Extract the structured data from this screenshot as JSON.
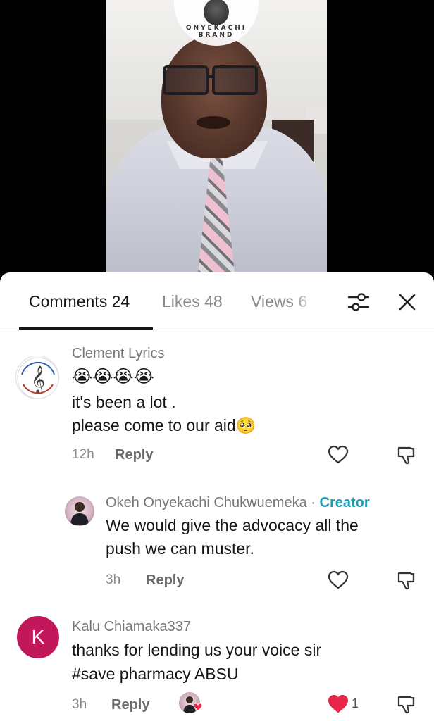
{
  "video": {
    "brand_text": "ONYEKACHI BRAND"
  },
  "tabs": {
    "comments": "Comments 24",
    "likes": "Likes 48",
    "views": "Views 6"
  },
  "icons": {
    "filter": "filter-sliders-icon",
    "close": "close-icon",
    "heart": "heart-icon",
    "dislike": "thumbs-down-icon"
  },
  "colors": {
    "creator": "#1aa0b8",
    "heart_liked": "#e8264a",
    "avatar_k": "#c2185b"
  },
  "comments": [
    {
      "username": "Clement Lyrics",
      "emoji_line": "😭😭😭😭",
      "line1": "it's been a lot .",
      "line2": "please come to our aid🥺",
      "time": "12h",
      "reply_label": "Reply"
    },
    {
      "username": "Okeh Onyekachi Chukwuemeka",
      "separator": "·",
      "badge": "Creator",
      "line1": "We would give the advocacy all the",
      "line2": "push we can muster.",
      "time": "3h",
      "reply_label": "Reply"
    },
    {
      "avatar_letter": "K",
      "username": "Kalu Chiamaka337",
      "line1": "thanks for lending us your voice sir",
      "line2": "#save pharmacy ABSU",
      "time": "3h",
      "reply_label": "Reply",
      "like_count": "1"
    }
  ]
}
